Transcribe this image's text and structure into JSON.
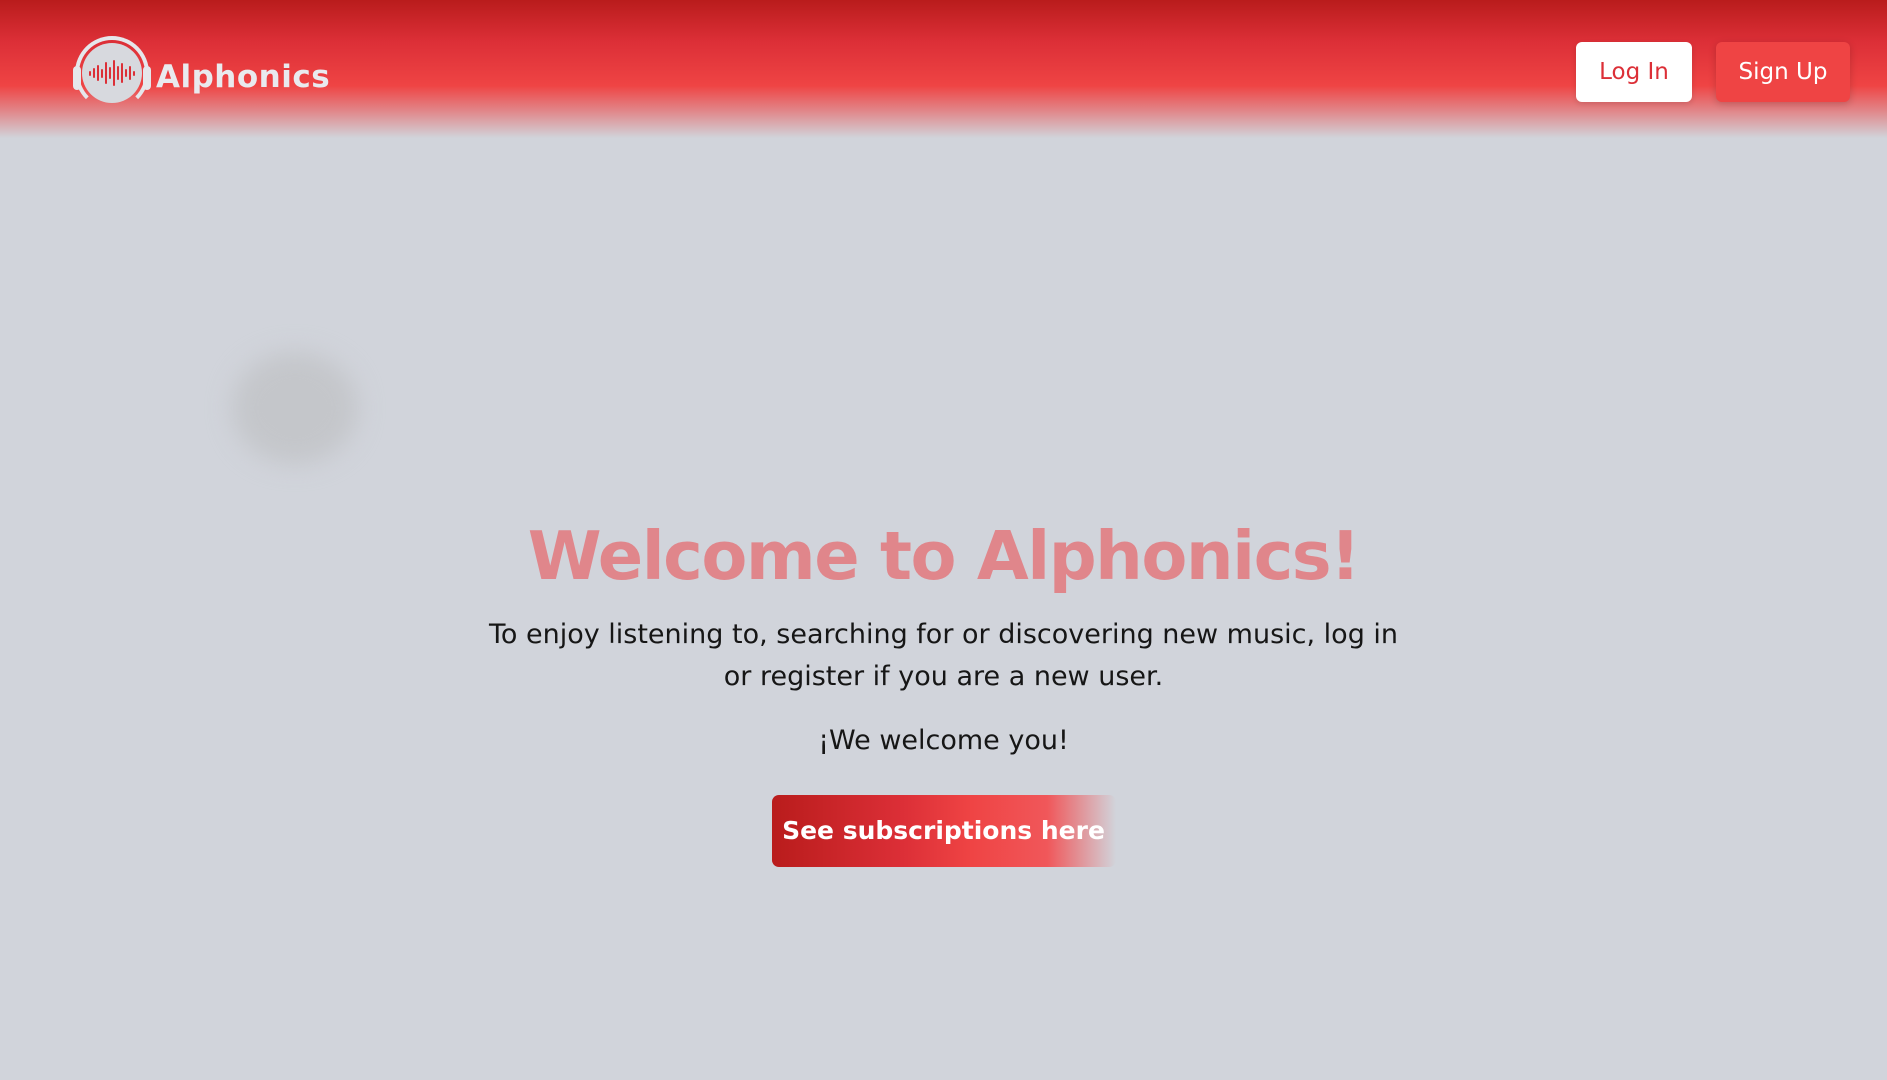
{
  "header": {
    "brand_name": "Alphonics",
    "login_label": "Log In",
    "signup_label": "Sign Up"
  },
  "main": {
    "title": "Welcome to Alphonics!",
    "description": "To enjoy listening to, searching for or discovering new music, log in or register if you are a new user.",
    "welcome_line": "¡We welcome you!",
    "subscriptions_label": "See subscriptions here"
  },
  "icons": {
    "logo": "headphones-waveform-icon"
  },
  "colors": {
    "brand_red": "#dc2f37",
    "accent_red": "#ef4444",
    "dark_red": "#b91c1c",
    "title_pink": "#e0868b",
    "page_background": "#d1d4db"
  }
}
